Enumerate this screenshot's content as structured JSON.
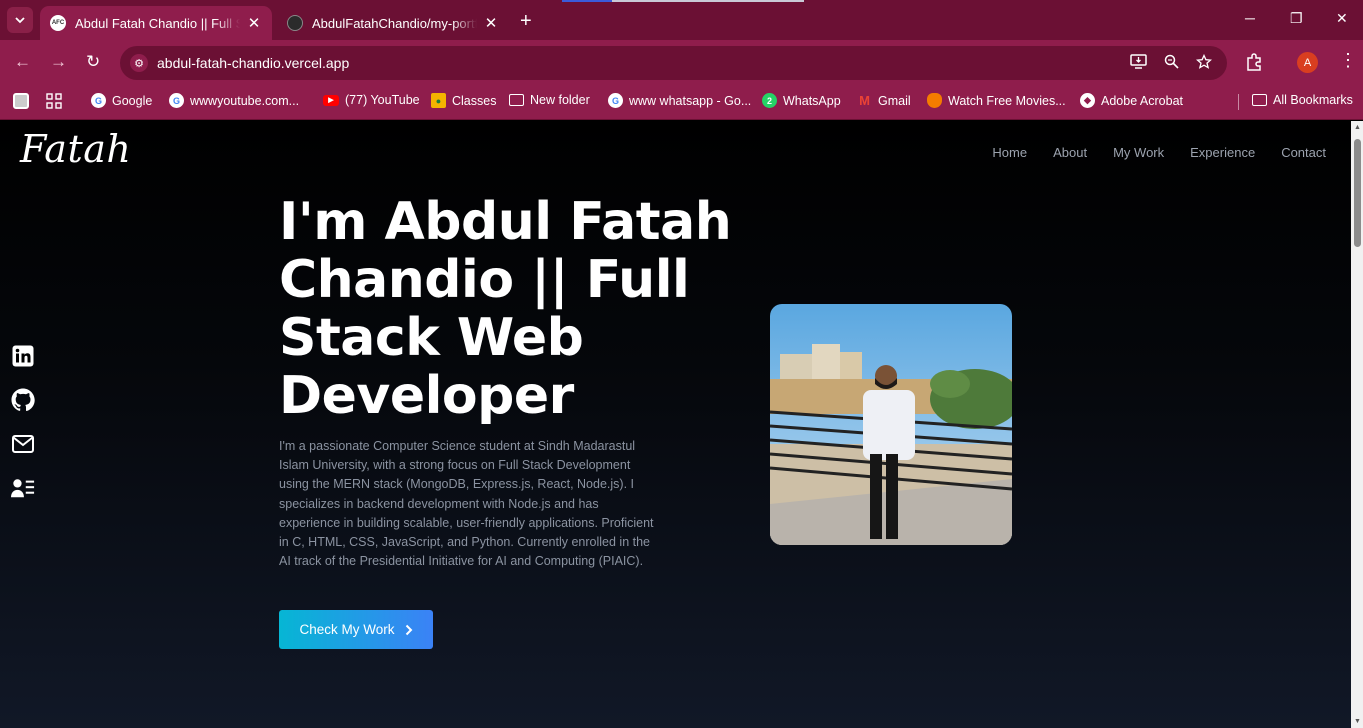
{
  "browser": {
    "tabs": [
      {
        "title": "Abdul Fatah Chandio || Full Stack Web Developer",
        "favicon": "AFC",
        "active": true
      },
      {
        "title": "AbdulFatahChandio/my-portfolio",
        "favicon": "",
        "active": false
      }
    ],
    "url": "abdul-fatah-chandio.vercel.app",
    "profile_initial": "A",
    "accent_color": "#8f1d4c",
    "bookmarks": [
      {
        "label": "Google",
        "icon": "google-icon"
      },
      {
        "label": "wwwyoutube.com...",
        "icon": "google-icon"
      },
      {
        "label": "(77) YouTube",
        "icon": "youtube-icon"
      },
      {
        "label": "Classes",
        "icon": "classroom-icon"
      },
      {
        "label": "New folder",
        "icon": "folder-icon"
      },
      {
        "label": "www whatsapp - Go...",
        "icon": "google-icon"
      },
      {
        "label": "WhatsApp",
        "icon": "whatsapp-icon",
        "badge": "2"
      },
      {
        "label": "Gmail",
        "icon": "gmail-icon"
      },
      {
        "label": "Watch Free Movies...",
        "icon": "movies-icon"
      },
      {
        "label": "Adobe Acrobat",
        "icon": "acrobat-icon"
      }
    ],
    "all_bookmarks": "All Bookmarks"
  },
  "site": {
    "logo": "Fatah",
    "nav": [
      "Home",
      "About",
      "My Work",
      "Experience",
      "Contact"
    ],
    "social": [
      "linkedin-icon",
      "github-icon",
      "mail-icon",
      "resume-icon"
    ],
    "hero": {
      "title": "I'm Abdul Fatah Chandio || Full Stack Web Developer",
      "description": "I'm a passionate Computer Science student at Sindh Madarastul Islam University, with a strong focus on Full Stack Development using the MERN stack (MongoDB, Express.js, React, Node.js). I specializes in backend development with Node.js and has experience in building scalable, user-friendly applications. Proficient in C, HTML, CSS, JavaScript, and Python. Currently enrolled in the AI track of the Presidential Initiative for AI and Computing (PIAIC).",
      "cta": "Check My Work",
      "cta_gradient": [
        "#06b6d4",
        "#3b82f6"
      ]
    }
  }
}
